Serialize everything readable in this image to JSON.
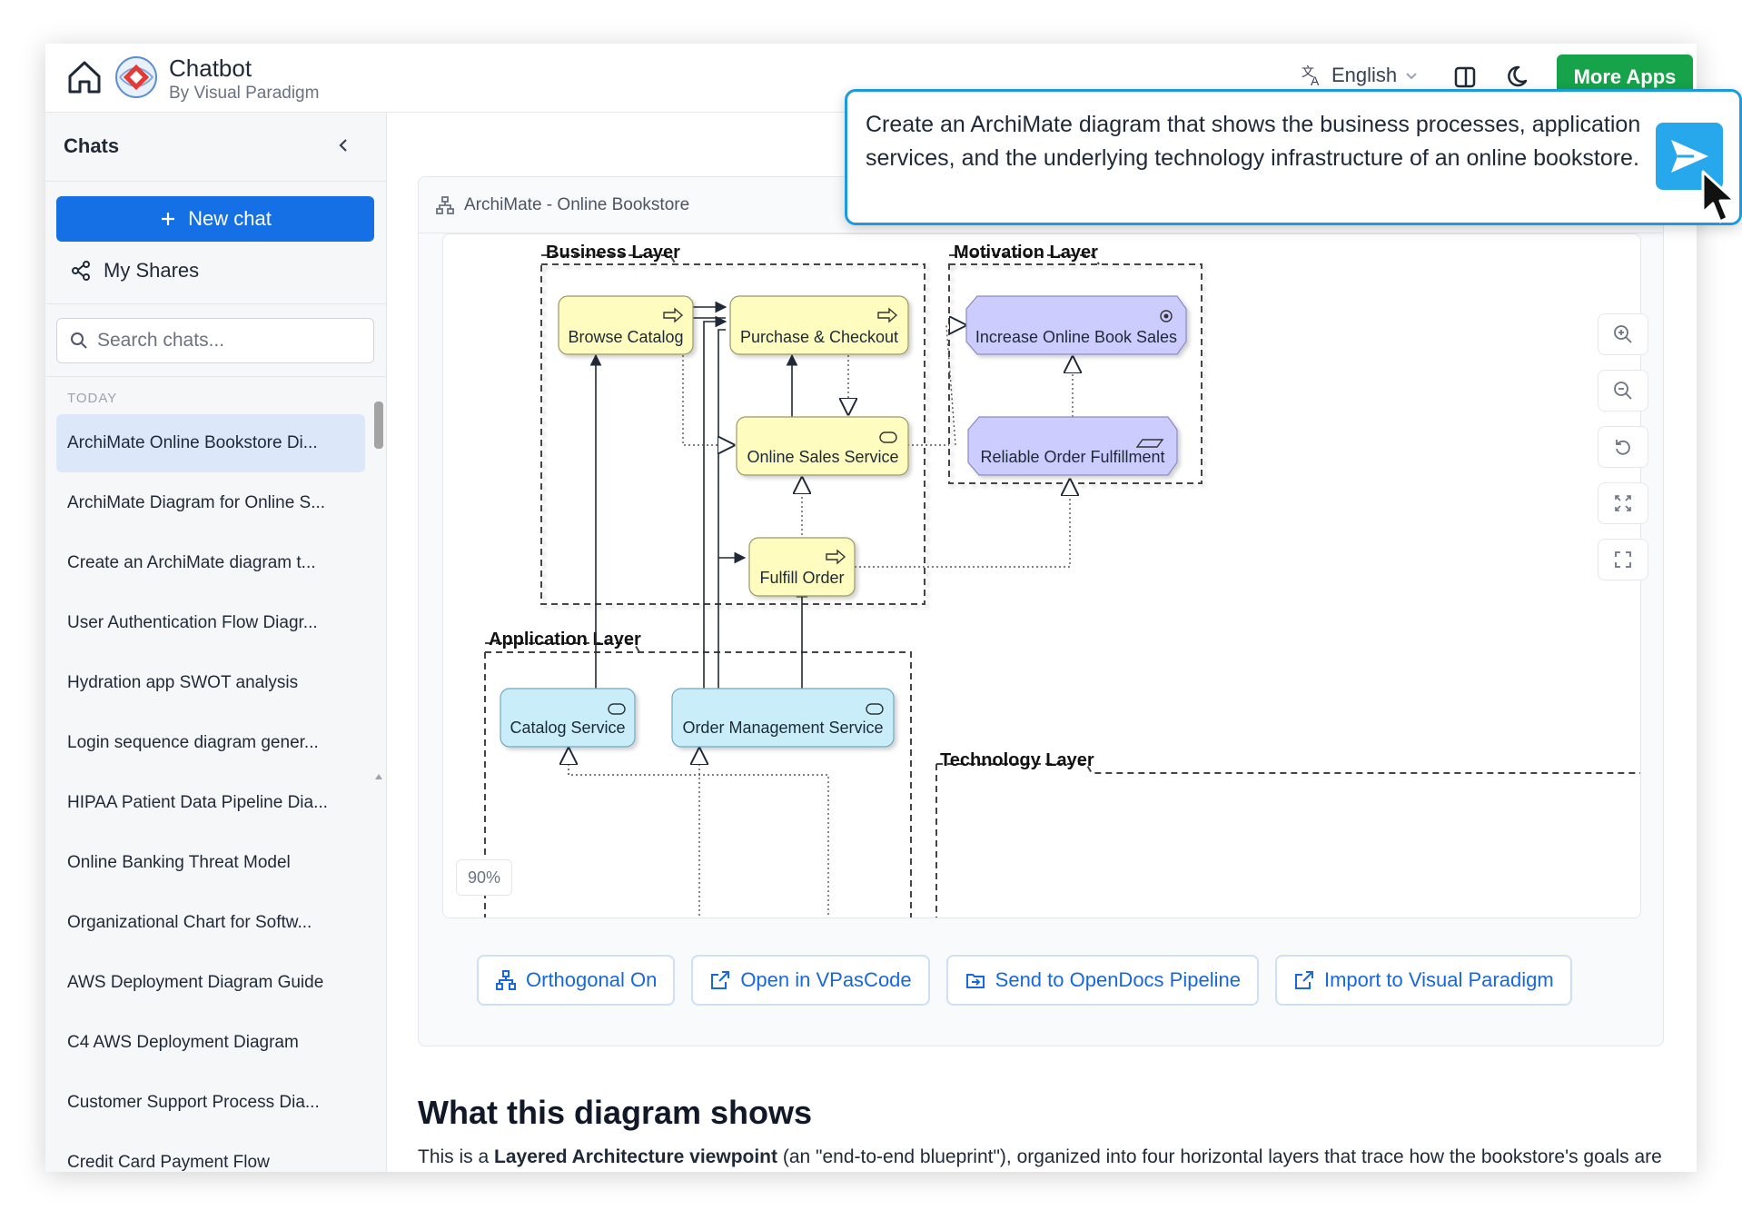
{
  "app": {
    "title": "Chatbot",
    "subtitle": "By Visual Paradigm",
    "language": "English",
    "more_apps": "More Apps"
  },
  "sidebar": {
    "title": "Chats",
    "new_chat": "New chat",
    "my_shares": "My Shares",
    "search_placeholder": "Search chats...",
    "section": "TODAY",
    "items": [
      "ArchiMate Online Bookstore Di...",
      "ArchiMate Diagram for Online S...",
      "Create an ArchiMate diagram t...",
      "User Authentication Flow Diagr...",
      "Hydration app SWOT analysis",
      "Login sequence diagram gener...",
      "HIPAA Patient Data Pipeline Dia...",
      "Online Banking Threat Model",
      "Organizational Chart for Softw...",
      "AWS Deployment Diagram Guide",
      "C4 AWS Deployment Diagram",
      "Customer Support Process Dia...",
      "Credit Card Payment Flow"
    ]
  },
  "diagram": {
    "card_title": "ArchiMate - Online Bookstore",
    "zoom": "90%",
    "layers": {
      "business": "Business Layer",
      "motivation": "Motivation Layer",
      "application": "Application Layer",
      "technology": "Technology Layer"
    },
    "nodes": {
      "browse": "Browse Catalog",
      "purchase": "Purchase & Checkout",
      "sales": "Online Sales Service",
      "fulfill": "Fulfill Order",
      "increase": "Increase Online Book Sales",
      "reliable": "Reliable Order Fulfillment",
      "catalog_svc": "Catalog Service",
      "order_svc": "Order Management Service"
    },
    "colors": {
      "business": "#fefcbf",
      "motivation": "#ccccff",
      "application": "#c9eefa"
    }
  },
  "actions": {
    "orthogonal": "Orthogonal On",
    "open_vpascode": "Open in VPasCode",
    "send_opendocs": "Send to OpenDocs Pipeline",
    "import_vp": "Import to Visual Paradigm"
  },
  "content": {
    "heading": "What this diagram shows",
    "p_prefix": "This is a ",
    "p_bold": "Layered Architecture viewpoint",
    "p_suffix": " (an \"end-to-end blueprint\"), organized into four horizontal layers that trace how the bookstore's goals are realized all the way down to the physical infrastructure:"
  },
  "prompt": {
    "text": "Create an ArchiMate diagram that shows the business processes, application services, and the underlying technology infrastructure of an online bookstore."
  }
}
